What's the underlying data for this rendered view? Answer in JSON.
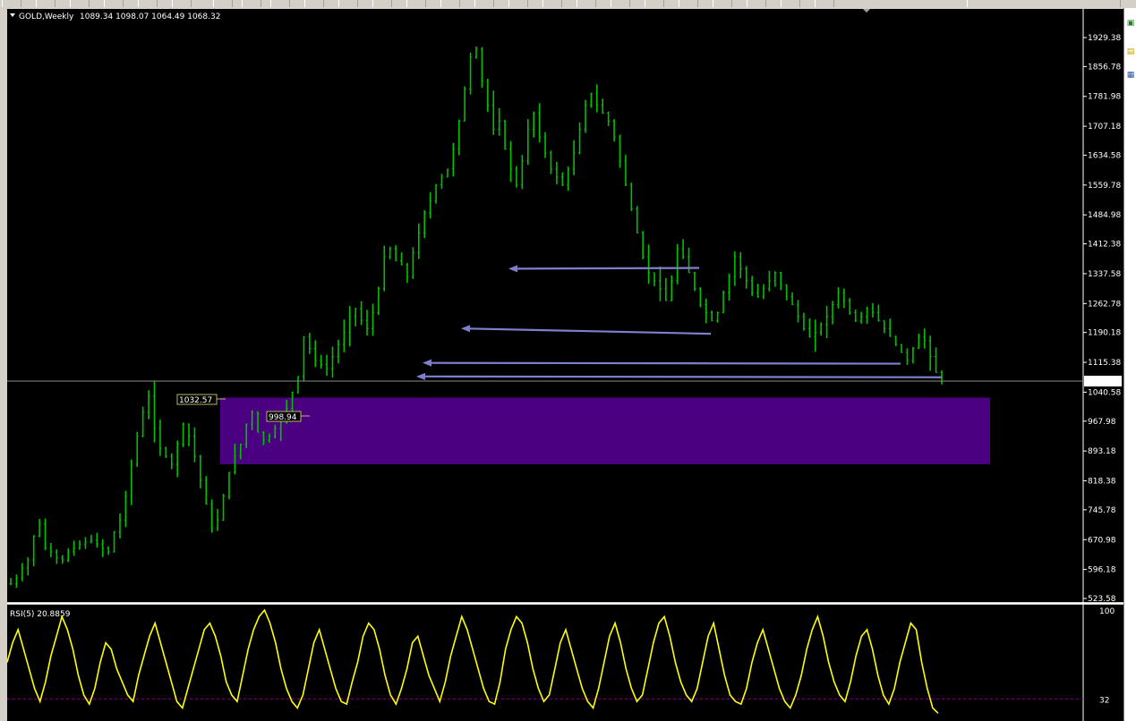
{
  "window": {
    "symbol_header": "GOLD,Weekly",
    "ohlc_header": "1089.34 1098.07 1064.49 1068.32"
  },
  "chart_data": [
    {
      "type": "candlestick",
      "title": "GOLD,Weekly",
      "ohlc_last": {
        "open": 1089.34,
        "high": 1098.07,
        "low": 1064.49,
        "close": 1068.32
      },
      "y_axis_ticks": [
        "1929.38",
        "1856.78",
        "1781.98",
        "1707.18",
        "1634.58",
        "1559.78",
        "1484.98",
        "1412.38",
        "1337.58",
        "1262.78",
        "1190.18",
        "1115.38",
        "1040.58",
        "967.98",
        "893.18",
        "818.38",
        "745.78",
        "670.98",
        "596.18",
        "523.58"
      ],
      "ylim": [
        500,
        1950
      ],
      "current_price_label": "1068.32",
      "price_tags": [
        {
          "label": "1032.57",
          "value": 1032.57
        },
        {
          "label": "998.94",
          "value": 998.94
        }
      ],
      "zone": {
        "y_top": 1027,
        "y_bottom": 860,
        "color": "#4b0082"
      },
      "arrows": [
        {
          "y_start": 1352,
          "y_end": 1350
        },
        {
          "y_start": 1187,
          "y_end": 1200
        },
        {
          "y_start": 1112,
          "y_end": 1114
        },
        {
          "y_start": 1078,
          "y_end": 1080
        }
      ],
      "price_series": [
        560,
        575,
        600,
        620,
        680,
        710,
        650,
        640,
        625,
        620,
        640,
        650,
        660,
        665,
        670,
        660,
        650,
        640,
        690,
        720,
        780,
        860,
        930,
        990,
        1030,
        950,
        900,
        880,
        860,
        910,
        960,
        930,
        880,
        820,
        760,
        700,
        720,
        780,
        840,
        880,
        910,
        960,
        990,
        940,
        920,
        930,
        950,
        970,
        1000,
        1040,
        1080,
        1180,
        1150,
        1120,
        1110,
        1100,
        1130,
        1160,
        1190,
        1230,
        1250,
        1220,
        1200,
        1240,
        1300,
        1380,
        1400,
        1370,
        1360,
        1330,
        1390,
        1440,
        1490,
        1520,
        1560,
        1580,
        1600,
        1650,
        1720,
        1800,
        1880,
        1900,
        1820,
        1760,
        1700,
        1720,
        1650,
        1600,
        1560,
        1620,
        1700,
        1740,
        1680,
        1640,
        1600,
        1580,
        1560,
        1600,
        1640,
        1700,
        1760,
        1790,
        1760,
        1740,
        1720,
        1680,
        1620,
        1560,
        1500,
        1440,
        1380,
        1340,
        1320,
        1300,
        1270,
        1320,
        1400,
        1380,
        1340,
        1300,
        1260,
        1240,
        1220,
        1240,
        1290,
        1330,
        1380,
        1350,
        1320,
        1290,
        1280,
        1300,
        1320,
        1340,
        1310,
        1280,
        1260,
        1230,
        1200,
        1180,
        1190,
        1210,
        1230,
        1260,
        1290,
        1270,
        1240,
        1220,
        1230,
        1250,
        1240,
        1220,
        1200,
        1180,
        1160,
        1140,
        1120,
        1150,
        1180,
        1170,
        1130,
        1090,
        1068
      ]
    },
    {
      "type": "line",
      "title": "RSI(5) 20.8859",
      "series": [
        {
          "name": "RSI(5)",
          "color": "#ffff00"
        }
      ],
      "ylim": [
        0,
        100
      ],
      "y_axis_ticks": [
        "100",
        "32"
      ],
      "level_line": 32,
      "values": [
        60,
        75,
        85,
        70,
        55,
        40,
        30,
        45,
        65,
        80,
        95,
        85,
        70,
        50,
        35,
        28,
        40,
        60,
        75,
        70,
        55,
        45,
        35,
        30,
        50,
        65,
        80,
        90,
        75,
        60,
        45,
        30,
        25,
        40,
        55,
        70,
        85,
        90,
        80,
        65,
        45,
        35,
        30,
        50,
        70,
        85,
        95,
        100,
        90,
        75,
        55,
        40,
        30,
        25,
        35,
        55,
        75,
        85,
        70,
        55,
        40,
        30,
        28,
        45,
        60,
        80,
        90,
        85,
        70,
        50,
        35,
        28,
        40,
        55,
        75,
        80,
        65,
        50,
        40,
        30,
        45,
        65,
        80,
        95,
        85,
        70,
        55,
        40,
        30,
        28,
        45,
        70,
        85,
        95,
        90,
        75,
        55,
        40,
        30,
        35,
        55,
        75,
        85,
        70,
        55,
        40,
        30,
        25,
        40,
        60,
        80,
        90,
        75,
        55,
        40,
        30,
        35,
        55,
        75,
        90,
        95,
        80,
        60,
        45,
        35,
        30,
        40,
        60,
        80,
        90,
        70,
        50,
        35,
        30,
        28,
        40,
        60,
        75,
        85,
        70,
        55,
        40,
        30,
        25,
        35,
        50,
        70,
        85,
        95,
        80,
        60,
        45,
        35,
        30,
        45,
        65,
        80,
        85,
        70,
        50,
        35,
        28,
        40,
        60,
        75,
        90,
        85,
        60,
        40,
        25,
        21
      ]
    }
  ],
  "rsi_header": "RSI(5) 20.8859",
  "colors": {
    "background": "#000000",
    "candle_color": "#00c000",
    "zone": "#4b0082",
    "arrow": "#7f7fcf",
    "rsi_line": "#ffff00",
    "level_line": "#8b008b",
    "current_price_line": "#8c8c8c"
  }
}
